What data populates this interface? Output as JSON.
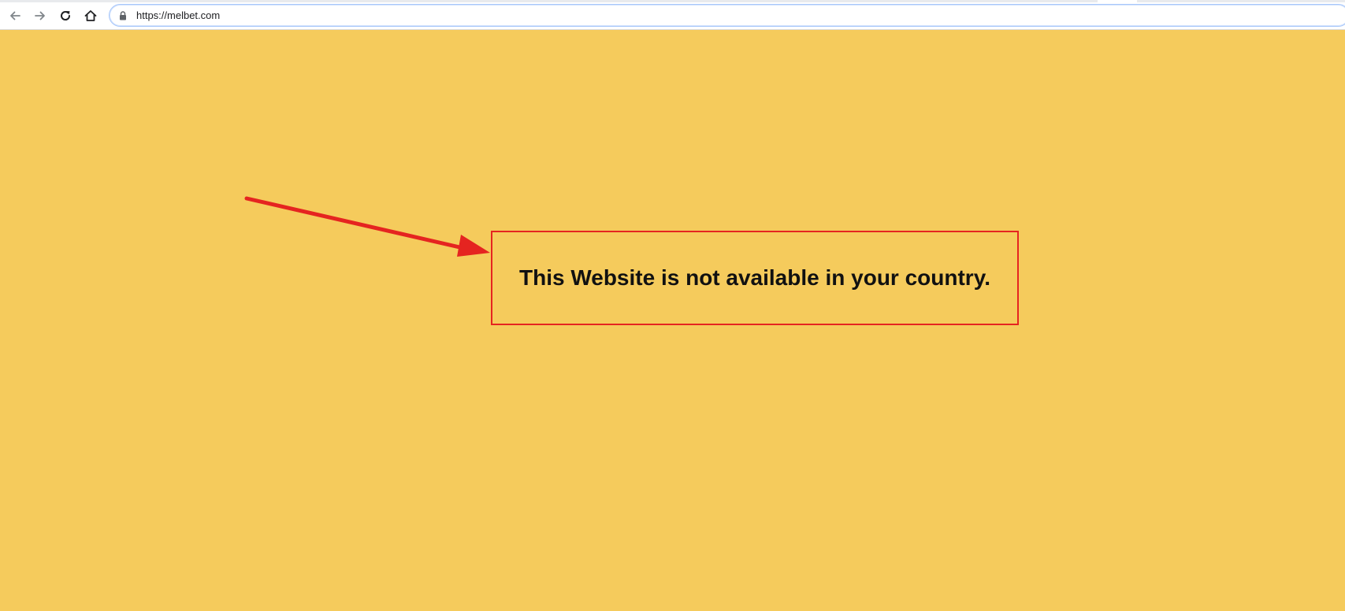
{
  "browser": {
    "url": "https://melbet.com",
    "buttons": {
      "back_icon": "arrow-left",
      "forward_icon": "arrow-right",
      "reload_icon": "reload",
      "home_icon": "home"
    }
  },
  "page": {
    "background_color": "#f5cb5c",
    "notice_message": "This Website is not available in your country.",
    "annotation_color": "#e52420"
  }
}
